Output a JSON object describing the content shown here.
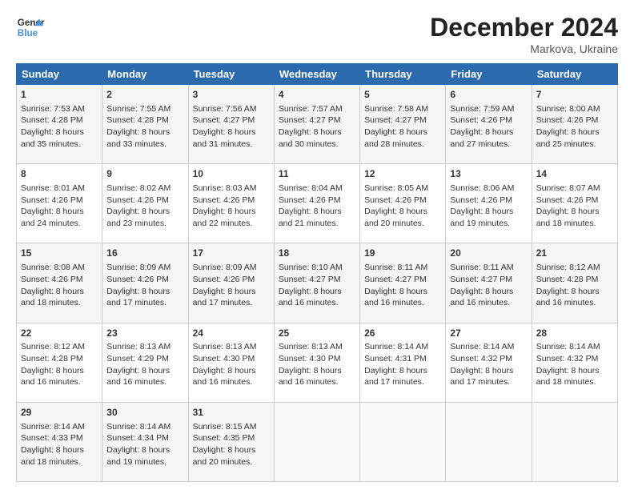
{
  "logo": {
    "line1": "General",
    "line2": "Blue"
  },
  "title": "December 2024",
  "location": "Markova, Ukraine",
  "days_header": [
    "Sunday",
    "Monday",
    "Tuesday",
    "Wednesday",
    "Thursday",
    "Friday",
    "Saturday"
  ],
  "weeks": [
    [
      {
        "day": "1",
        "sunrise": "7:53 AM",
        "sunset": "4:28 PM",
        "daylight": "8 hours and 35 minutes."
      },
      {
        "day": "2",
        "sunrise": "7:55 AM",
        "sunset": "4:28 PM",
        "daylight": "8 hours and 33 minutes."
      },
      {
        "day": "3",
        "sunrise": "7:56 AM",
        "sunset": "4:27 PM",
        "daylight": "8 hours and 31 minutes."
      },
      {
        "day": "4",
        "sunrise": "7:57 AM",
        "sunset": "4:27 PM",
        "daylight": "8 hours and 30 minutes."
      },
      {
        "day": "5",
        "sunrise": "7:58 AM",
        "sunset": "4:27 PM",
        "daylight": "8 hours and 28 minutes."
      },
      {
        "day": "6",
        "sunrise": "7:59 AM",
        "sunset": "4:26 PM",
        "daylight": "8 hours and 27 minutes."
      },
      {
        "day": "7",
        "sunrise": "8:00 AM",
        "sunset": "4:26 PM",
        "daylight": "8 hours and 25 minutes."
      }
    ],
    [
      {
        "day": "8",
        "sunrise": "8:01 AM",
        "sunset": "4:26 PM",
        "daylight": "8 hours and 24 minutes."
      },
      {
        "day": "9",
        "sunrise": "8:02 AM",
        "sunset": "4:26 PM",
        "daylight": "8 hours and 23 minutes."
      },
      {
        "day": "10",
        "sunrise": "8:03 AM",
        "sunset": "4:26 PM",
        "daylight": "8 hours and 22 minutes."
      },
      {
        "day": "11",
        "sunrise": "8:04 AM",
        "sunset": "4:26 PM",
        "daylight": "8 hours and 21 minutes."
      },
      {
        "day": "12",
        "sunrise": "8:05 AM",
        "sunset": "4:26 PM",
        "daylight": "8 hours and 20 minutes."
      },
      {
        "day": "13",
        "sunrise": "8:06 AM",
        "sunset": "4:26 PM",
        "daylight": "8 hours and 19 minutes."
      },
      {
        "day": "14",
        "sunrise": "8:07 AM",
        "sunset": "4:26 PM",
        "daylight": "8 hours and 18 minutes."
      }
    ],
    [
      {
        "day": "15",
        "sunrise": "8:08 AM",
        "sunset": "4:26 PM",
        "daylight": "8 hours and 18 minutes."
      },
      {
        "day": "16",
        "sunrise": "8:09 AM",
        "sunset": "4:26 PM",
        "daylight": "8 hours and 17 minutes."
      },
      {
        "day": "17",
        "sunrise": "8:09 AM",
        "sunset": "4:26 PM",
        "daylight": "8 hours and 17 minutes."
      },
      {
        "day": "18",
        "sunrise": "8:10 AM",
        "sunset": "4:27 PM",
        "daylight": "8 hours and 16 minutes."
      },
      {
        "day": "19",
        "sunrise": "8:11 AM",
        "sunset": "4:27 PM",
        "daylight": "8 hours and 16 minutes."
      },
      {
        "day": "20",
        "sunrise": "8:11 AM",
        "sunset": "4:27 PM",
        "daylight": "8 hours and 16 minutes."
      },
      {
        "day": "21",
        "sunrise": "8:12 AM",
        "sunset": "4:28 PM",
        "daylight": "8 hours and 16 minutes."
      }
    ],
    [
      {
        "day": "22",
        "sunrise": "8:12 AM",
        "sunset": "4:28 PM",
        "daylight": "8 hours and 16 minutes."
      },
      {
        "day": "23",
        "sunrise": "8:13 AM",
        "sunset": "4:29 PM",
        "daylight": "8 hours and 16 minutes."
      },
      {
        "day": "24",
        "sunrise": "8:13 AM",
        "sunset": "4:30 PM",
        "daylight": "8 hours and 16 minutes."
      },
      {
        "day": "25",
        "sunrise": "8:13 AM",
        "sunset": "4:30 PM",
        "daylight": "8 hours and 16 minutes."
      },
      {
        "day": "26",
        "sunrise": "8:14 AM",
        "sunset": "4:31 PM",
        "daylight": "8 hours and 17 minutes."
      },
      {
        "day": "27",
        "sunrise": "8:14 AM",
        "sunset": "4:32 PM",
        "daylight": "8 hours and 17 minutes."
      },
      {
        "day": "28",
        "sunrise": "8:14 AM",
        "sunset": "4:32 PM",
        "daylight": "8 hours and 18 minutes."
      }
    ],
    [
      {
        "day": "29",
        "sunrise": "8:14 AM",
        "sunset": "4:33 PM",
        "daylight": "8 hours and 18 minutes."
      },
      {
        "day": "30",
        "sunrise": "8:14 AM",
        "sunset": "4:34 PM",
        "daylight": "8 hours and 19 minutes."
      },
      {
        "day": "31",
        "sunrise": "8:15 AM",
        "sunset": "4:35 PM",
        "daylight": "8 hours and 20 minutes."
      },
      null,
      null,
      null,
      null
    ]
  ],
  "labels": {
    "sunrise_prefix": "Sunrise: ",
    "sunset_prefix": "Sunset: ",
    "daylight_prefix": "Daylight: "
  }
}
